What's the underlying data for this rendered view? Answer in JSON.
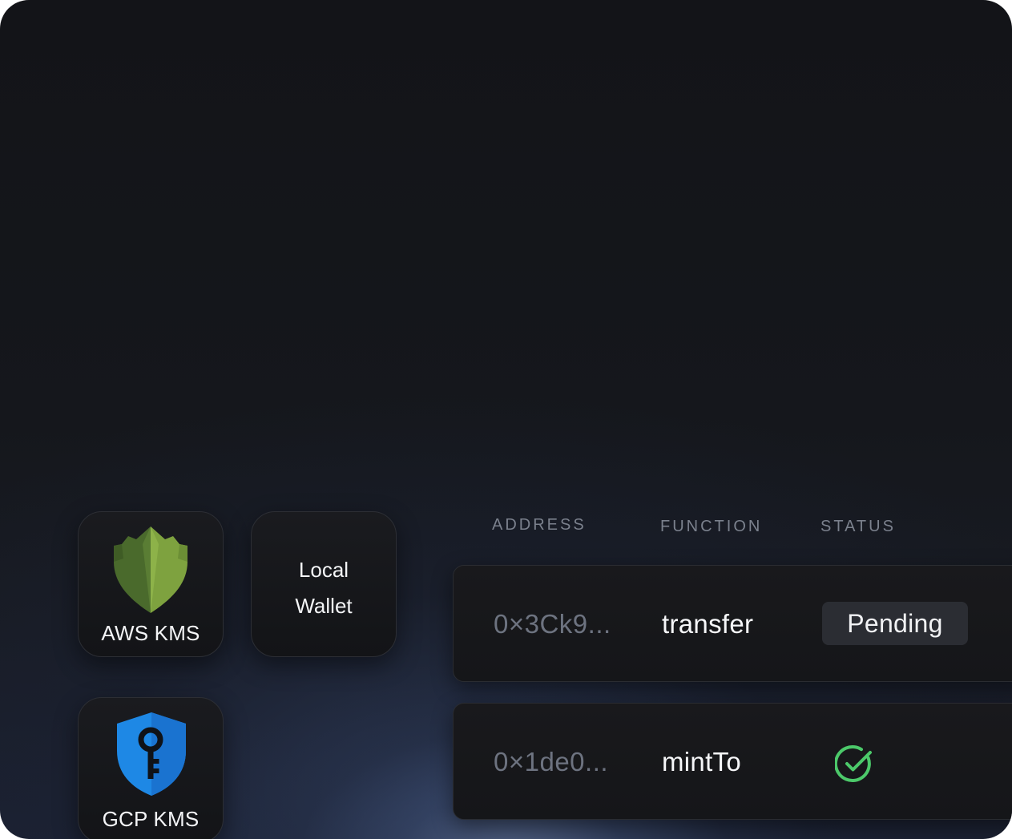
{
  "signers": {
    "aws": {
      "label": "AWS KMS",
      "icon": "aws-kms-shield-icon"
    },
    "local": {
      "line1": "Local",
      "line2": "Wallet"
    },
    "gcp": {
      "label": "GCP KMS",
      "icon": "gcp-key-shield-icon"
    }
  },
  "table": {
    "headers": {
      "address": "ADDRESS",
      "function": "FUNCTION",
      "status": "STATUS"
    },
    "rows": [
      {
        "address": "0×3Ck9...",
        "function": "transfer",
        "status": "Pending"
      },
      {
        "address": "0×1de0...",
        "function": "mintTo",
        "status_icon": "check-circle-icon"
      }
    ]
  },
  "colors": {
    "aws_green_dark": "#4c6b2e",
    "aws_green_light": "#7ea23f",
    "gcp_blue": "#1e88e5",
    "success_green": "#4cc96a"
  }
}
